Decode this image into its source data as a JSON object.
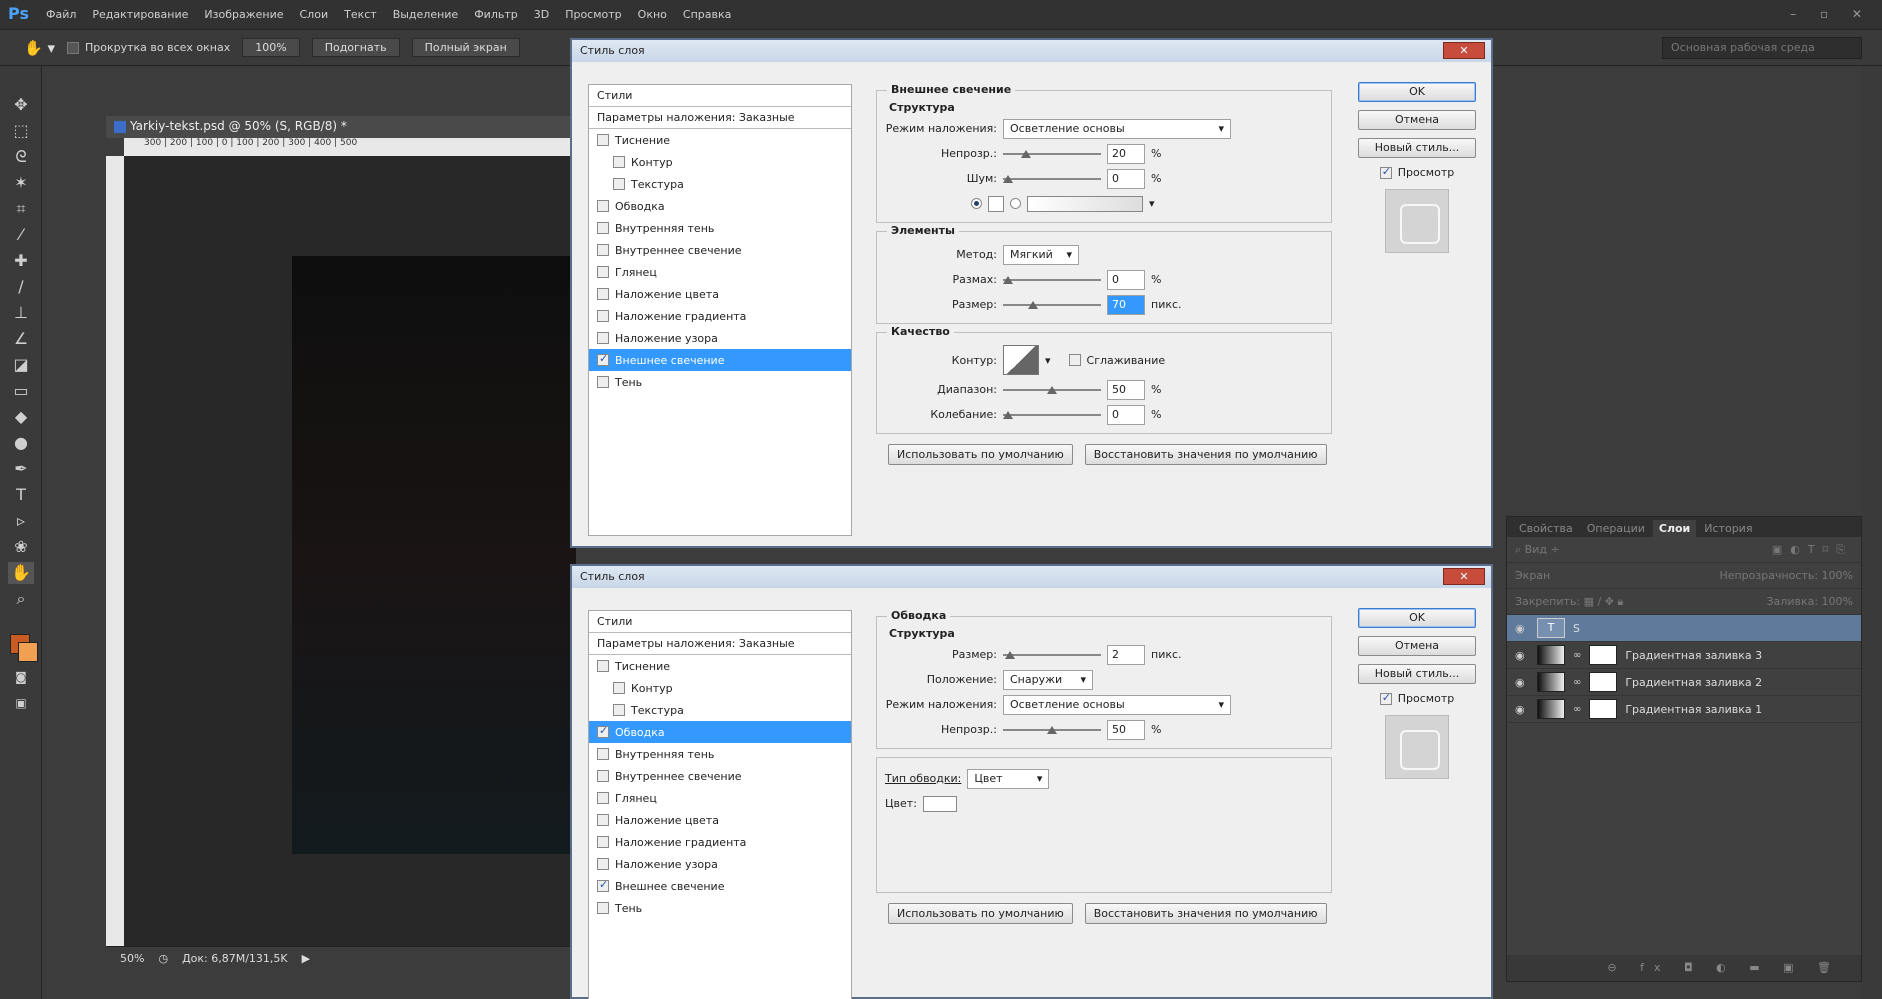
{
  "app": {
    "logo": "Ps"
  },
  "menu": [
    "Файл",
    "Редактирование",
    "Изображение",
    "Слои",
    "Текст",
    "Выделение",
    "Фильтр",
    "3D",
    "Просмотр",
    "Окно",
    "Справка"
  ],
  "options": {
    "scroll_all_label": "Прокрутка во всех окнах",
    "zoom_100": "100%",
    "fit_label": "Подогнать",
    "fullscreen_label": "Полный экран",
    "workspace": "Основная рабочая среда"
  },
  "document": {
    "tab_title": "Yarkiy-tekst.psd @ 50% (S, RGB/8) *",
    "ruler_marks": "300 | 200 | 100 | 0 | 100 | 200 | 300 | 400 | 500",
    "zoom": "50%",
    "doc_info": "Док: 6,87M/131,5K"
  },
  "layers_panel": {
    "tabs": [
      "Свойства",
      "Операции",
      "Слои",
      "История"
    ],
    "filter_label": "Вид",
    "blend_mode": "Экран",
    "opacity_label": "Непрозрачность:",
    "opacity_value": "100%",
    "lock_label": "Закрепить:",
    "fill_label": "Заливка:",
    "fill_value": "100%",
    "layers": [
      {
        "name": "S",
        "type": "text",
        "selected": true
      },
      {
        "name": "Градиентная заливка 3",
        "type": "fill",
        "selected": false
      },
      {
        "name": "Градиентная заливка 2",
        "type": "fill",
        "selected": false
      },
      {
        "name": "Градиентная заливка 1",
        "type": "fill",
        "selected": false
      }
    ]
  },
  "dialog_common": {
    "title": "Стиль слоя",
    "close": "✕",
    "styles_header": "Стили",
    "blend_options": "Параметры наложения: Заказные",
    "ok": "OK",
    "cancel": "Отмена",
    "new_style": "Новый стиль...",
    "preview": "Просмотр",
    "use_default": "Использовать по умолчанию",
    "reset_default": "Восстановить значения по умолчанию"
  },
  "dialog1": {
    "styles": [
      {
        "label": "Тиснение",
        "checked": false,
        "sub": false,
        "selected": false
      },
      {
        "label": "Контур",
        "checked": false,
        "sub": true,
        "selected": false
      },
      {
        "label": "Текстура",
        "checked": false,
        "sub": true,
        "selected": false
      },
      {
        "label": "Обводка",
        "checked": false,
        "sub": false,
        "selected": false
      },
      {
        "label": "Внутренняя тень",
        "checked": false,
        "sub": false,
        "selected": false
      },
      {
        "label": "Внутреннее свечение",
        "checked": false,
        "sub": false,
        "selected": false
      },
      {
        "label": "Глянец",
        "checked": false,
        "sub": false,
        "selected": false
      },
      {
        "label": "Наложение цвета",
        "checked": false,
        "sub": false,
        "selected": false
      },
      {
        "label": "Наложение градиента",
        "checked": false,
        "sub": false,
        "selected": false
      },
      {
        "label": "Наложение узора",
        "checked": false,
        "sub": false,
        "selected": false
      },
      {
        "label": "Внешнее свечение",
        "checked": true,
        "sub": false,
        "selected": true
      },
      {
        "label": "Тень",
        "checked": false,
        "sub": false,
        "selected": false
      }
    ],
    "section_title": "Внешнее свечение",
    "structure_title": "Структура",
    "blend_mode_label": "Режим наложения:",
    "blend_mode_value": "Осветление основы",
    "opacity_label": "Непрозр.:",
    "opacity_value": "20",
    "opacity_frac": 0.2,
    "noise_label": "Шум:",
    "noise_value": "0",
    "noise_frac": 0,
    "elements_title": "Элементы",
    "method_label": "Метод:",
    "method_value": "Мягкий",
    "spread_label": "Размах:",
    "spread_value": "0",
    "spread_frac": 0,
    "size_label": "Размер:",
    "size_value": "70",
    "size_frac": 0.28,
    "size_unit": "пикс.",
    "quality_title": "Качество",
    "contour_label": "Контур:",
    "antialias_label": "Сглаживание",
    "range_label": "Диапазон:",
    "range_value": "50",
    "range_frac": 0.5,
    "jitter_label": "Колебание:",
    "jitter_value": "0",
    "jitter_frac": 0,
    "percent": "%"
  },
  "dialog2": {
    "styles": [
      {
        "label": "Тиснение",
        "checked": false,
        "sub": false,
        "selected": false
      },
      {
        "label": "Контур",
        "checked": false,
        "sub": true,
        "selected": false
      },
      {
        "label": "Текстура",
        "checked": false,
        "sub": true,
        "selected": false
      },
      {
        "label": "Обводка",
        "checked": true,
        "sub": false,
        "selected": true
      },
      {
        "label": "Внутренняя тень",
        "checked": false,
        "sub": false,
        "selected": false
      },
      {
        "label": "Внутреннее свечение",
        "checked": false,
        "sub": false,
        "selected": false
      },
      {
        "label": "Глянец",
        "checked": false,
        "sub": false,
        "selected": false
      },
      {
        "label": "Наложение цвета",
        "checked": false,
        "sub": false,
        "selected": false
      },
      {
        "label": "Наложение градиента",
        "checked": false,
        "sub": false,
        "selected": false
      },
      {
        "label": "Наложение узора",
        "checked": false,
        "sub": false,
        "selected": false
      },
      {
        "label": "Внешнее свечение",
        "checked": true,
        "sub": false,
        "selected": false
      },
      {
        "label": "Тень",
        "checked": false,
        "sub": false,
        "selected": false
      }
    ],
    "section_title": "Обводка",
    "structure_title": "Структура",
    "size_label": "Размер:",
    "size_value": "2",
    "size_frac": 0.02,
    "size_unit": "пикс.",
    "position_label": "Положение:",
    "position_value": "Снаружи",
    "blend_mode_label": "Режим наложения:",
    "blend_mode_value": "Осветление основы",
    "opacity_label": "Непрозр.:",
    "opacity_value": "50",
    "opacity_frac": 0.5,
    "fill_type_label": "Тип обводки:",
    "fill_type_value": "Цвет",
    "color_label": "Цвет:",
    "percent": "%"
  },
  "colors": {
    "foreground": "#c85a24",
    "background": "#f0a050",
    "selection": "#3399ff"
  }
}
